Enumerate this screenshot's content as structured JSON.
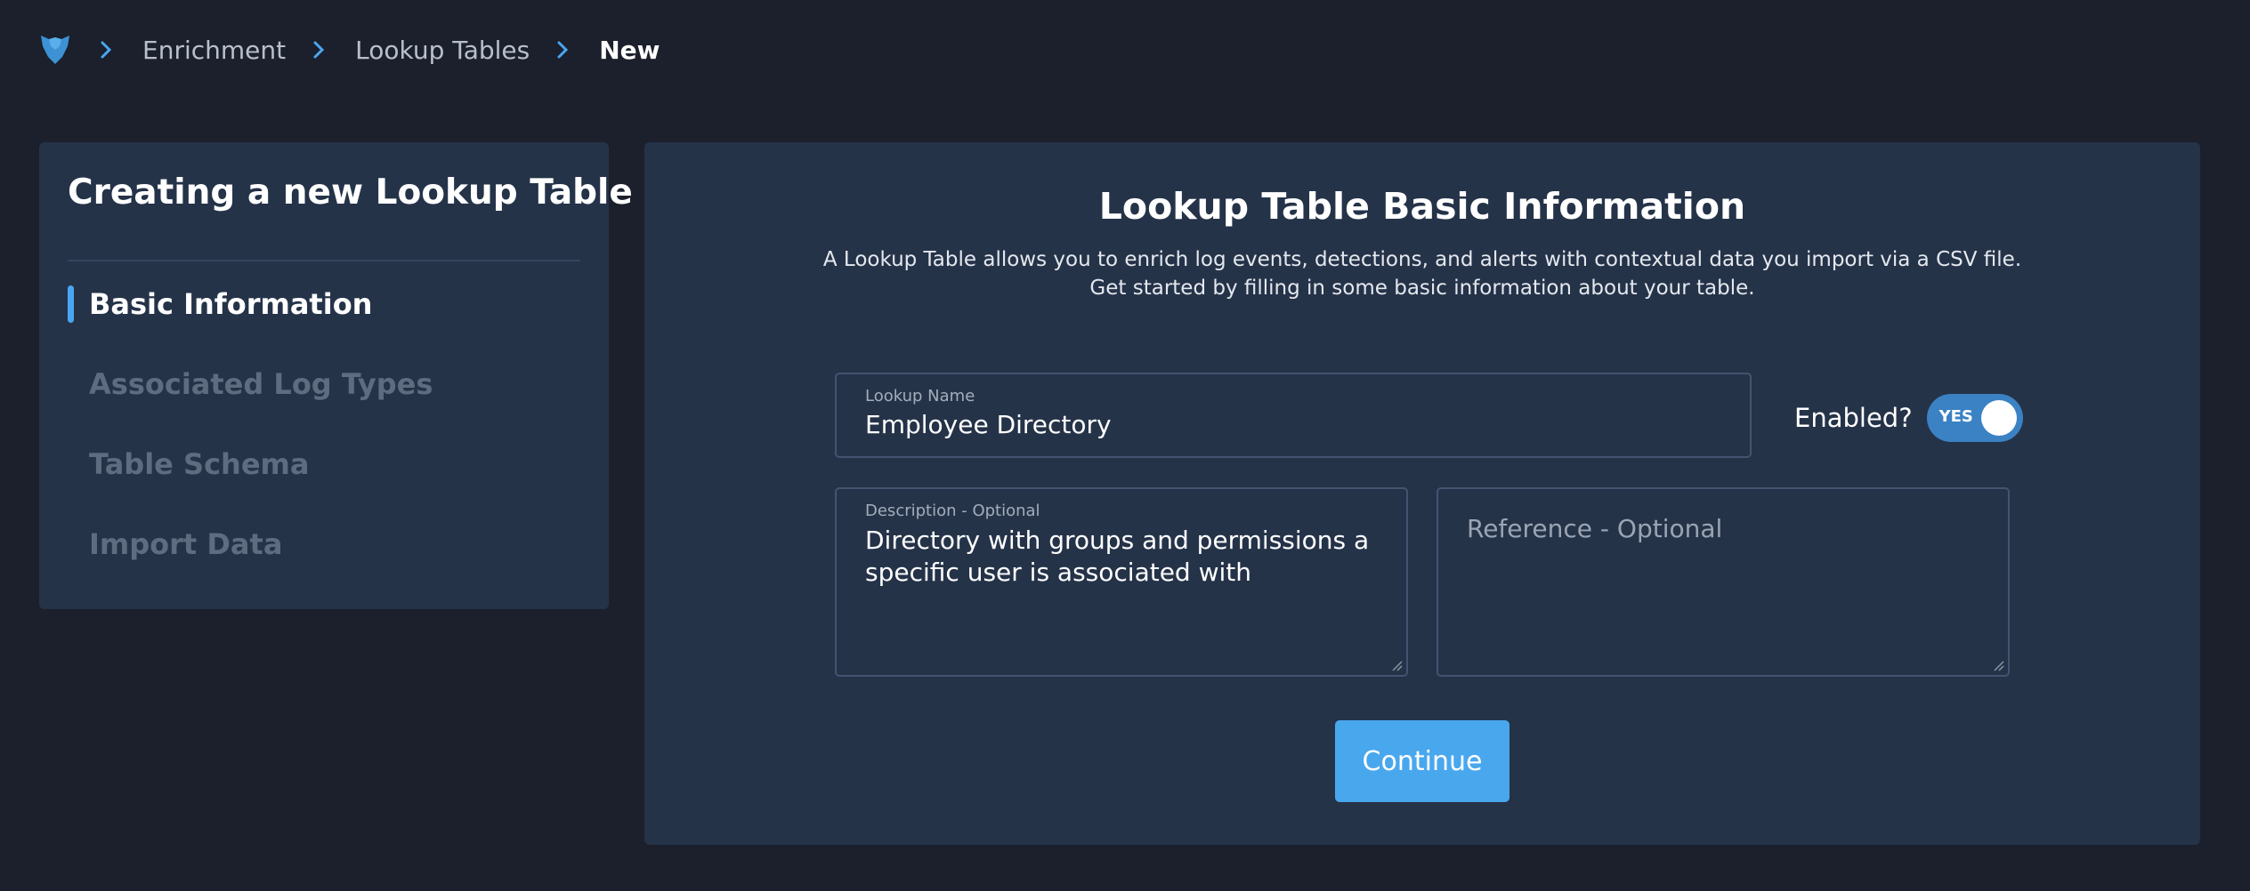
{
  "breadcrumb": {
    "logo_icon": "panther-logo-icon",
    "items": [
      {
        "label": "Enrichment"
      },
      {
        "label": "Lookup Tables"
      },
      {
        "label": "New"
      }
    ]
  },
  "sidebar": {
    "title": "Creating a new Lookup Table",
    "steps": [
      {
        "label": "Basic Information",
        "active": true
      },
      {
        "label": "Associated Log Types",
        "active": false
      },
      {
        "label": "Table Schema",
        "active": false
      },
      {
        "label": "Import Data",
        "active": false
      }
    ]
  },
  "main": {
    "title": "Lookup Table Basic Information",
    "description_line1": "A Lookup Table allows you to enrich log events, detections, and alerts with contextual data you import via a CSV file.",
    "description_line2": "Get started by filling in some basic information about your table.",
    "name_field": {
      "label": "Lookup Name",
      "value": "Employee Directory"
    },
    "enabled": {
      "label": "Enabled?",
      "toggle_text": "YES",
      "on": true
    },
    "description_field": {
      "label": "Description - Optional",
      "value": "Directory with groups and permissions a specific user is associated with"
    },
    "reference_field": {
      "placeholder": "Reference - Optional",
      "value": ""
    },
    "continue_label": "Continue"
  },
  "colors": {
    "background": "#1b202c",
    "panel": "#253349",
    "accent": "#49a7ee",
    "toggle_on": "#3b82c4",
    "inactive_step": "#5e6c80"
  }
}
